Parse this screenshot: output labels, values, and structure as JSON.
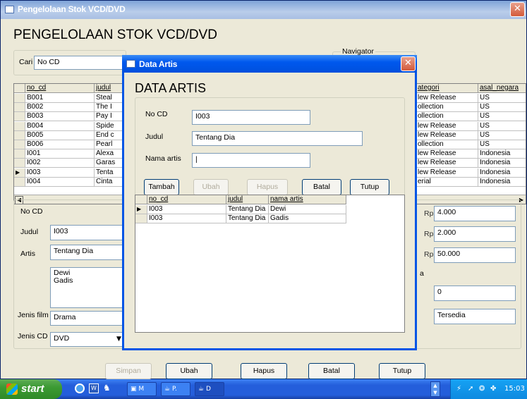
{
  "main_window": {
    "title": "Pengelolaan Stok VCD/DVD",
    "heading": "PENGELOLAAN STOK VCD/DVD",
    "close_glyph": "✕",
    "search": {
      "label": "Cari",
      "value": "No CD"
    },
    "navigator_label": "Navigator",
    "grid_left": {
      "headers": [
        "no_cd",
        "judul"
      ],
      "rows": [
        [
          "B001",
          "Steal"
        ],
        [
          "B002",
          "The I"
        ],
        [
          "B003",
          "Pay I"
        ],
        [
          "B004",
          "Spide"
        ],
        [
          "B005",
          "End c"
        ],
        [
          "B006",
          "Pearl"
        ],
        [
          "I001",
          "Alexa"
        ],
        [
          "I002",
          "Garas"
        ],
        [
          "I003",
          "Tenta"
        ],
        [
          "I004",
          "Cinta"
        ]
      ],
      "current_row_marker": "▶"
    },
    "grid_right": {
      "headers": [
        "ategori",
        "asal_negara"
      ],
      "rows": [
        [
          "lew Release",
          "US"
        ],
        [
          "ollection",
          "US"
        ],
        [
          "ollection",
          "US"
        ],
        [
          "lew Release",
          "US"
        ],
        [
          "lew Release",
          "US"
        ],
        [
          "ollection",
          "US"
        ],
        [
          "lew Release",
          "Indonesia"
        ],
        [
          "lew Release",
          "Indonesia"
        ],
        [
          "lew Release",
          "Indonesia"
        ],
        [
          "erial",
          "Indonesia"
        ]
      ]
    },
    "form": {
      "no_cd": {
        "label": "No CD",
        "value": "I003"
      },
      "judul": {
        "label": "Judul",
        "value": "Tentang Dia"
      },
      "artis": {
        "label": "Artis",
        "lines": [
          "Dewi",
          "Gadis"
        ]
      },
      "jenis_film": {
        "label": "Jenis film",
        "value": "Drama"
      },
      "jenis_cd": {
        "label": "Jenis CD",
        "value": "DVD"
      },
      "price1": {
        "currency": "Rp",
        "value": "4.000"
      },
      "price2": {
        "currency": "Rp",
        "value": "2.000"
      },
      "price3": {
        "currency": "Rp",
        "value": "50.000"
      },
      "stok_value": "0",
      "partial_label": "a",
      "status_value": "Tersedia"
    },
    "buttons": {
      "simpan": "Simpan",
      "ubah": "Ubah",
      "hapus": "Hapus",
      "batal": "Batal",
      "tutup": "Tutup"
    },
    "button_keys": {
      "simpan": "S",
      "ubah": "U",
      "hapus": "H",
      "batal": "B",
      "tutup": "T"
    }
  },
  "dialog": {
    "title": "Data Artis",
    "heading": "DATA ARTIS",
    "close_glyph": "✕",
    "no_cd": {
      "label": "No CD",
      "value": "I003"
    },
    "judul": {
      "label": "Judul",
      "value": "Tentang Dia"
    },
    "nama_artis": {
      "label": "Nama artis",
      "value": "|"
    },
    "buttons": {
      "tambah": "Tambah",
      "ubah": "Ubah",
      "hapus": "Hapus",
      "batal": "Batal",
      "tutup": "Tutup"
    },
    "grid": {
      "headers": [
        "no_cd",
        "judul",
        "nama artis"
      ],
      "rows": [
        [
          "I003",
          "Tentang Dia",
          "Dewi"
        ],
        [
          "I003",
          "Tentang Dia",
          "Gadis"
        ]
      ],
      "current_row_marker": "▶"
    }
  },
  "taskbar": {
    "start_label": "start",
    "tasks": [
      {
        "icon": "ie-icon",
        "label": ""
      },
      {
        "icon": "word-icon",
        "label": ""
      },
      {
        "icon": "app-icon",
        "label": ""
      },
      {
        "icon": "window-icon",
        "label": "M"
      },
      {
        "icon": "java-icon",
        "label": "P."
      },
      {
        "icon": "java-icon",
        "label": "D"
      }
    ],
    "clock": "15:03"
  },
  "colors": {
    "xp_blue": "#0055e5",
    "start_green": "#3c9a33",
    "window_bg": "#ece9d8",
    "selected_row": "#316ac5"
  }
}
